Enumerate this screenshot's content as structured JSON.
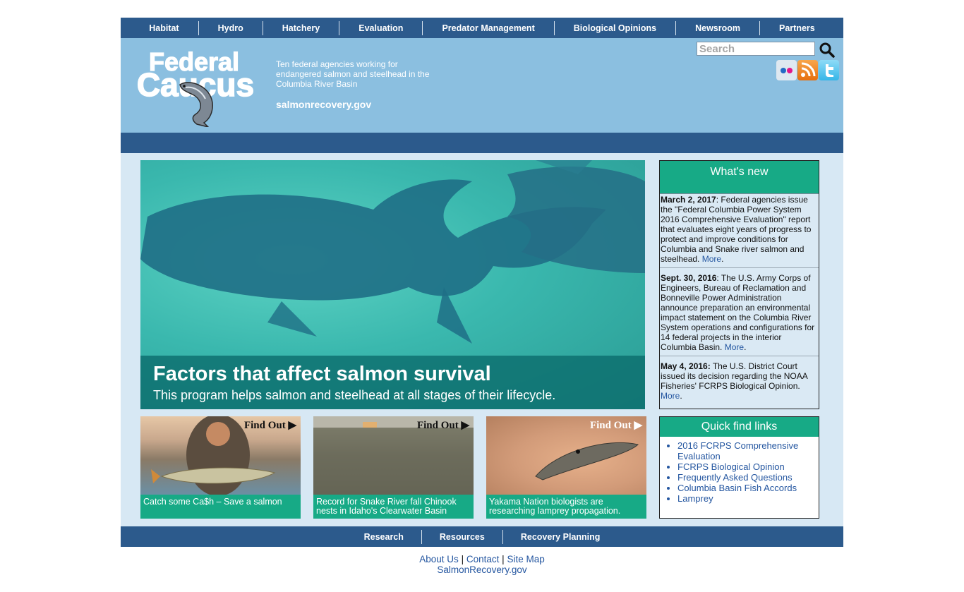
{
  "topnav": {
    "items": [
      "Habitat",
      "Hydro",
      "Hatchery",
      "Evaluation",
      "Predator Management",
      "Biological Opinions",
      "Newsroom",
      "Partners"
    ]
  },
  "header": {
    "logo": {
      "line1": "Federal",
      "line2": "Caucus"
    },
    "tagline": "Ten federal agencies working for endangered salmon and steelhead in the Columbia River Basin",
    "domain": "salmonrecovery.gov",
    "search_placeholder": "Search",
    "social_icons": [
      "flickr-icon",
      "rss-icon",
      "twitter-icon"
    ]
  },
  "hero": {
    "title": "Factors that affect salmon survival",
    "subtitle": "This program helps salmon and steelhead at all stages of their lifecycle."
  },
  "cards": [
    {
      "badge": "Find Out ▶",
      "caption": "Catch some Ca$h – Save a salmon"
    },
    {
      "badge": "Find Out ▶",
      "caption": "Record for Snake River fall Chinook nests in Idaho's Clearwater Basin"
    },
    {
      "badge": "Find Out ▶",
      "caption": "Yakama Nation biologists are researching lamprey propagation."
    }
  ],
  "whats_new": {
    "heading": "What's new",
    "items": [
      {
        "date": "March 2, 2017",
        "text": ": Federal agencies issue the \"Federal Columbia Power System 2016 Comprehensive Evaluation\" report that evaluates eight years of progress to protect and improve conditions for Columbia and Snake river salmon and steelhead. ",
        "more": "More",
        "tail": "."
      },
      {
        "date": "Sept. 30, 2016",
        "text": ": The U.S. Army Corps of Engineers, Bureau of Reclamation and Bonneville Power Administration announce preparation an environmental impact statement on the Columbia River System operations and configurations for 14 federal projects in the interior Columbia Basin. ",
        "more": "More",
        "tail": "."
      },
      {
        "date": "May 4, 2016:",
        "text": " The U.S. District Court issued its decision regarding the NOAA Fisheries' FCRPS Biological Opinion. ",
        "more": "More",
        "tail": "."
      }
    ]
  },
  "quick_links": {
    "heading": "Quick find links",
    "items": [
      "2016 FCRPS Comprehensive Evaluation",
      "FCRPS Biological Opinion",
      "Frequently Asked Questions",
      "Columbia Basin Fish Accords",
      "Lamprey"
    ]
  },
  "bottomnav": {
    "items": [
      "Research",
      "Resources",
      "Recovery Planning"
    ]
  },
  "footer": {
    "links": [
      "About Us",
      "Contact",
      "Site Map"
    ],
    "separator": "|",
    "site": "SalmonRecovery.gov"
  },
  "colors": {
    "nav_blue": "#2c5a8c",
    "header_blue": "#8bbfe0",
    "accent_green": "#17aa86",
    "link_blue": "#2456a0"
  }
}
